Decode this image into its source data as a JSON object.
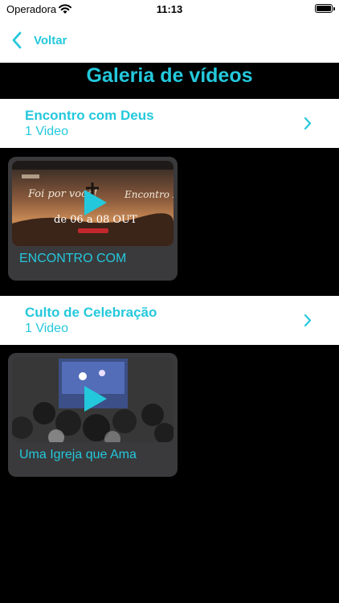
{
  "status": {
    "carrier": "Operadora",
    "time": "11:13"
  },
  "nav": {
    "back_label": "Voltar"
  },
  "page": {
    "title": "Galeria de vídeos"
  },
  "albums": [
    {
      "title": "Encontro com Deus",
      "count": "1 Video",
      "video": {
        "title": "ENCONTRO COM",
        "thumb_text_main": "de 06 a 08 OUT",
        "thumb_text_left": "Foi por você!",
        "thumb_text_right": "Encontro Deus"
      }
    },
    {
      "title": "Culto de Celebração",
      "count": "1 Video",
      "video": {
        "title": "Uma Igreja que Ama"
      }
    }
  ],
  "colors": {
    "accent": "#24c8dc",
    "background": "#000000",
    "card": "#3a3a3c"
  }
}
